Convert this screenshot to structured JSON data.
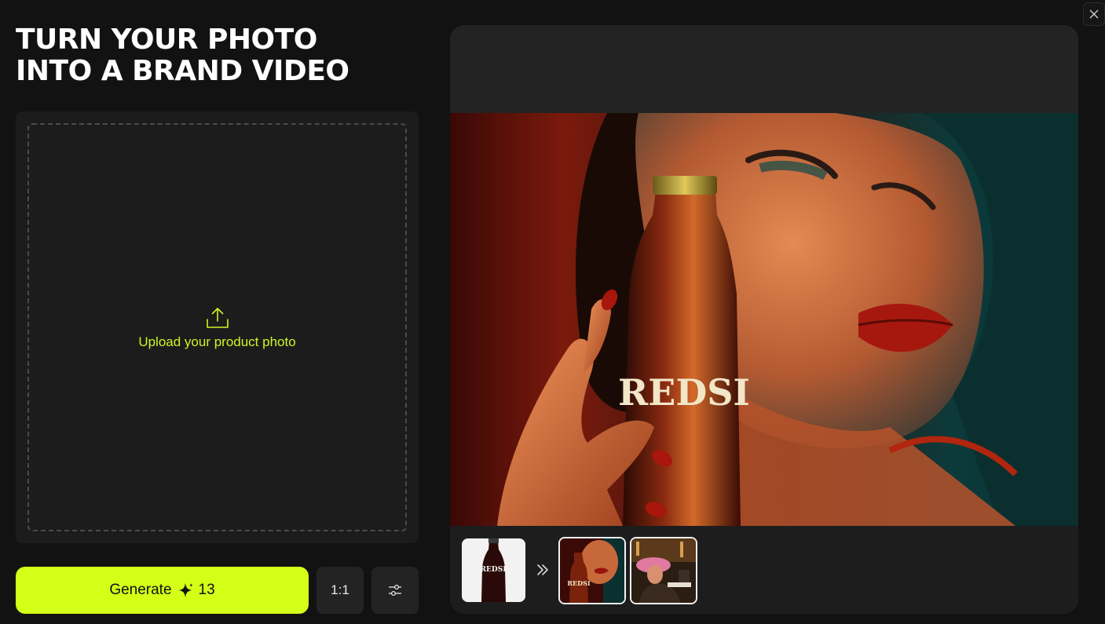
{
  "headline": {
    "line1": "TURN YOUR PHOTO",
    "line2": "INTO A BRAND VIDEO"
  },
  "upload": {
    "label": "Upload your product photo",
    "icon": "upload-icon"
  },
  "actions": {
    "generate_label": "Generate",
    "credits": "13",
    "credits_icon": "sparkle-icon",
    "aspect_ratio": "1:1",
    "settings_icon": "sliders-icon",
    "close_icon": "close-icon"
  },
  "preview": {
    "brand_text": "REDSI",
    "thumbnails": [
      {
        "name": "source-thumbnail",
        "brand_text": "REDSI"
      },
      {
        "name": "output-thumbnail-1",
        "brand_text": "REDSI"
      },
      {
        "name": "output-thumbnail-2"
      }
    ],
    "arrow_icon": "double-chevron-right-icon"
  },
  "colors": {
    "accent": "#d4ff17",
    "background": "#121212",
    "panel": "#1c1c1c"
  }
}
